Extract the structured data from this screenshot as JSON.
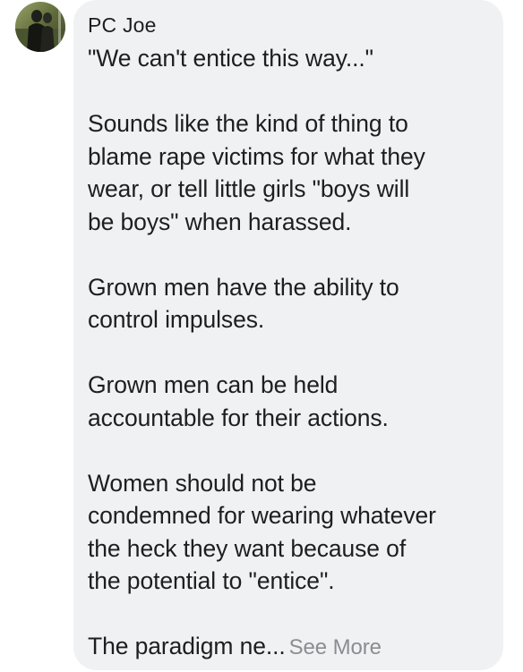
{
  "comment": {
    "author": "PC Joe",
    "lines": [
      "\"We can't entice this way...\"",
      "",
      "Sounds like the kind of thing to",
      "blame rape victims for what they",
      "wear, or tell little girls \"boys will",
      "be boys\" when harassed.",
      "",
      "Grown men have the ability to",
      "control impulses.",
      "",
      "Grown men can be held",
      "accountable for their actions.",
      "",
      "Women should not be",
      "condemned for wearing whatever",
      "the heck they want because of",
      "the potential to \"entice\".",
      ""
    ],
    "truncated_line": "The paradigm ne...",
    "see_more_label": "See More"
  },
  "colors": {
    "bubble_bg": "#f0f1f3",
    "text": "#1c1e21",
    "muted": "#8a8d91"
  },
  "icons": {
    "avatar": "profile-photo"
  }
}
